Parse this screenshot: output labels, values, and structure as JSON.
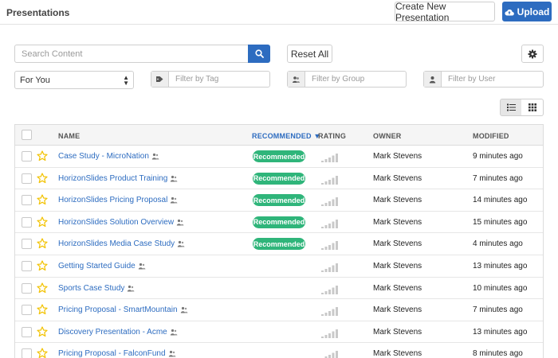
{
  "header": {
    "title": "Presentations",
    "create_label": "Create New Presentation",
    "upload_label": "Upload"
  },
  "search": {
    "placeholder": "Search Content",
    "reset_label": "Reset All"
  },
  "filters": {
    "scope_value": "For You",
    "tag_placeholder": "Filter by Tag",
    "group_placeholder": "Filter by Group",
    "user_placeholder": "Filter by User"
  },
  "table": {
    "columns": {
      "name": "NAME",
      "recommended": "RECOMMENDED",
      "sort_indicator": "▼",
      "rating": "RATING",
      "owner": "OWNER",
      "modified": "MODIFIED"
    },
    "rows": [
      {
        "name": "Case Study - MicroNation",
        "recommended": "Recommended",
        "owner": "Mark Stevens",
        "modified": "9 minutes ago"
      },
      {
        "name": "HorizonSlides Product Training",
        "recommended": "Recommended",
        "owner": "Mark Stevens",
        "modified": "7 minutes ago"
      },
      {
        "name": "HorizonSlides Pricing Proposal",
        "recommended": "Recommended",
        "owner": "Mark Stevens",
        "modified": "14 minutes ago"
      },
      {
        "name": "HorizonSlides Solution Overview",
        "recommended": "Recommended",
        "owner": "Mark Stevens",
        "modified": "15 minutes ago"
      },
      {
        "name": "HorizonSlides Media Case Study",
        "recommended": "Recommended",
        "owner": "Mark Stevens",
        "modified": "4 minutes ago"
      },
      {
        "name": "Getting Started Guide",
        "recommended": "",
        "owner": "Mark Stevens",
        "modified": "13 minutes ago"
      },
      {
        "name": "Sports Case Study",
        "recommended": "",
        "owner": "Mark Stevens",
        "modified": "10 minutes ago"
      },
      {
        "name": "Pricing Proposal - SmartMountain",
        "recommended": "",
        "owner": "Mark Stevens",
        "modified": "7 minutes ago"
      },
      {
        "name": "Discovery Presentation - Acme",
        "recommended": "",
        "owner": "Mark Stevens",
        "modified": "13 minutes ago"
      },
      {
        "name": "Pricing Proposal - FalconFund",
        "recommended": "",
        "owner": "Mark Stevens",
        "modified": "8 minutes ago"
      }
    ]
  },
  "colors": {
    "accent": "#2d6cc0",
    "badge": "#2fb57a",
    "star": "#f2c200"
  },
  "icons": [
    "cloud-upload-icon",
    "search-icon",
    "gear-icon",
    "tag-icon",
    "group-icon",
    "user-icon",
    "list-view-icon",
    "grid-view-icon",
    "star-icon",
    "group-share-icon",
    "rating-bars-icon"
  ]
}
